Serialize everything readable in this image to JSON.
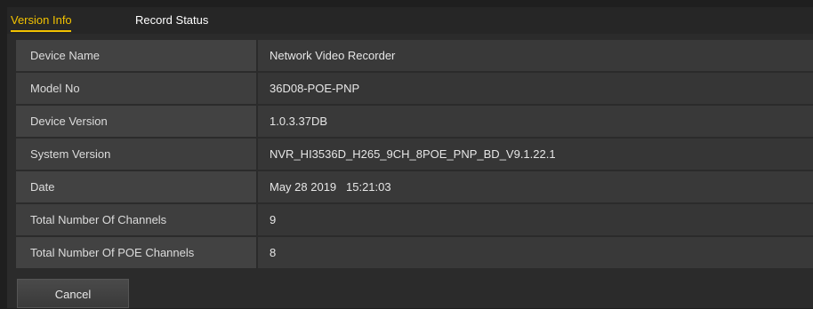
{
  "tabs": [
    {
      "label": "Version Info",
      "active": true
    },
    {
      "label": "Record Status",
      "active": false
    }
  ],
  "info_rows": [
    {
      "label": "Device Name",
      "value": "Network Video Recorder"
    },
    {
      "label": "Model No",
      "value": "36D08-POE-PNP"
    },
    {
      "label": "Device Version",
      "value": "1.0.3.37DB"
    },
    {
      "label": "System Version",
      "value": "NVR_HI3536D_H265_9CH_8POE_PNP_BD_V9.1.22.1"
    },
    {
      "label": "Date",
      "value": "May 28 2019   15:21:03"
    },
    {
      "label": "Total Number Of Channels",
      "value": "9"
    },
    {
      "label": "Total Number Of POE Channels",
      "value": "8"
    }
  ],
  "buttons": {
    "cancel_label": "Cancel"
  },
  "colors": {
    "accent": "#f2c200",
    "background": "#1f1f1f",
    "panel": "#2b2b2b"
  }
}
